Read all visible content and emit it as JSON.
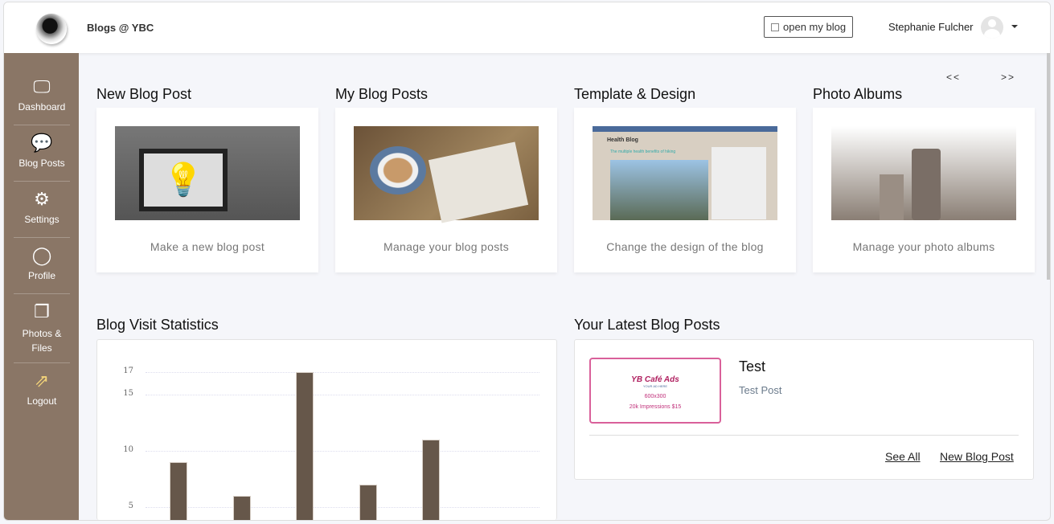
{
  "header": {
    "brand": "Blogs @ YBC",
    "open_blog": "open my blog",
    "user_name": "Stephanie Fulcher"
  },
  "sidebar": {
    "items": [
      {
        "label": "Dashboard",
        "icon": "monitor-icon"
      },
      {
        "label": "Blog Posts",
        "icon": "chat-icon"
      },
      {
        "label": "Settings",
        "icon": "gear-icon"
      },
      {
        "label": "Profile",
        "icon": "user-icon"
      },
      {
        "label": "Photos & Files",
        "icon": "folders-icon"
      },
      {
        "label": "Logout",
        "icon": "share-icon"
      }
    ]
  },
  "nav": {
    "prev": "<<",
    "next": ">>"
  },
  "cards": [
    {
      "title": "New Blog Post",
      "caption": "Make a new blog post"
    },
    {
      "title": "My Blog Posts",
      "caption": "Manage your blog posts"
    },
    {
      "title": "Template & Design",
      "caption": "Change the design of the blog",
      "preview_title": "Health Blog",
      "preview_post": "The multiple health benefits of hiking"
    },
    {
      "title": "Photo Albums",
      "caption": "Manage your photo albums"
    }
  ],
  "stats": {
    "title": "Blog Visit Statistics"
  },
  "chart_data": {
    "type": "bar",
    "values": [
      9,
      6,
      17,
      7,
      11
    ],
    "yticks": [
      5,
      10,
      15,
      17
    ],
    "grid": true,
    "color": "#66574a"
  },
  "latest": {
    "title": "Your Latest Blog Posts",
    "post_title": "Test",
    "post_excerpt": "Test Post",
    "ad_brand": "YB Café Ads",
    "ad_tagline": "YOUR AD HERE",
    "ad_size": "600x300",
    "ad_price": "20k Impressions $15",
    "see_all": "See All",
    "new_post": "New Blog Post"
  }
}
